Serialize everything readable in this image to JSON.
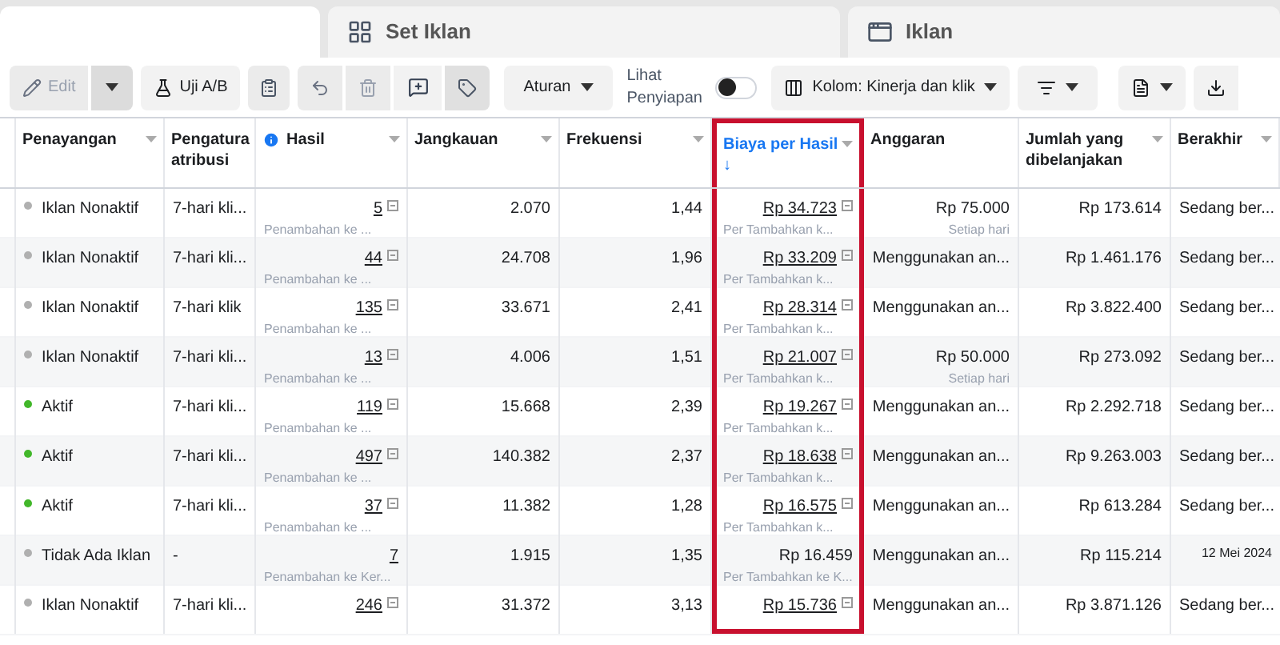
{
  "tabs": [
    {
      "selected": true
    },
    {
      "label": "Set Iklan",
      "selected": false
    },
    {
      "label": "Iklan",
      "selected": false
    }
  ],
  "toolbar": {
    "edit": "Edit",
    "ab_test": "Uji A/B",
    "rules": "Aturan",
    "preview_label": "Lihat Penyiapan",
    "preview_on": false,
    "columns": "Kolom: Kinerja dan klik"
  },
  "columns": [
    {
      "label": "Penayangan",
      "menu": true,
      "info": false,
      "highlighted": false
    },
    {
      "label": "Pengatura atribusi",
      "menu": false,
      "info": false,
      "highlighted": false
    },
    {
      "label": "Hasil",
      "menu": true,
      "info": true,
      "highlighted": false
    },
    {
      "label": "Jangkauan",
      "menu": true,
      "info": false,
      "highlighted": false
    },
    {
      "label": "Frekuensi",
      "menu": true,
      "info": false,
      "highlighted": false
    },
    {
      "label": "Biaya per Hasil",
      "sort_arrow": "↓",
      "menu": true,
      "info": false,
      "highlighted": true
    },
    {
      "label": "Anggaran",
      "menu": false,
      "info": false,
      "highlighted": false
    },
    {
      "label": "Jumlah yang dibelanjakan",
      "menu": true,
      "info": false,
      "highlighted": false
    },
    {
      "label": "Berakhir",
      "menu": true,
      "info": false,
      "highlighted": false
    }
  ],
  "rows": [
    {
      "status": "Iklan Nonaktif",
      "active": false,
      "attribution": "7-hari kli...",
      "result": "5",
      "result_linked": true,
      "result_sub": "Penambahan ke ...",
      "reach": "2.070",
      "frequency": "1,44",
      "cost": "Rp 34.723",
      "cost_linked": true,
      "cost_sub": "Per Tambahkan k...",
      "budget": "Rp 75.000",
      "budget_sub": "Setiap hari",
      "spent": "Rp 173.614",
      "ends": "Sedang ber...",
      "ends_is_date": false
    },
    {
      "status": "Iklan Nonaktif",
      "active": false,
      "attribution": "7-hari kli...",
      "result": "44",
      "result_linked": true,
      "result_sub": "Penambahan ke ...",
      "reach": "24.708",
      "frequency": "1,96",
      "cost": "Rp 33.209",
      "cost_linked": true,
      "cost_sub": "Per Tambahkan k...",
      "budget": "Menggunakan an...",
      "spent": "Rp 1.461.176",
      "ends": "Sedang ber...",
      "ends_is_date": false
    },
    {
      "status": "Iklan Nonaktif",
      "active": false,
      "attribution": "7-hari klik",
      "result": "135",
      "result_linked": true,
      "result_sub": "Penambahan ke ...",
      "reach": "33.671",
      "frequency": "2,41",
      "cost": "Rp 28.314",
      "cost_linked": true,
      "cost_sub": "Per Tambahkan k...",
      "budget": "Menggunakan an...",
      "spent": "Rp 3.822.400",
      "ends": "Sedang ber...",
      "ends_is_date": false
    },
    {
      "status": "Iklan Nonaktif",
      "active": false,
      "attribution": "7-hari kli...",
      "result": "13",
      "result_linked": true,
      "result_sub": "Penambahan ke ...",
      "reach": "4.006",
      "frequency": "1,51",
      "cost": "Rp 21.007",
      "cost_linked": true,
      "cost_sub": "Per Tambahkan k...",
      "budget": "Rp 50.000",
      "budget_sub": "Setiap hari",
      "spent": "Rp 273.092",
      "ends": "Sedang ber...",
      "ends_is_date": false
    },
    {
      "status": "Aktif",
      "active": true,
      "attribution": "7-hari kli...",
      "result": "119",
      "result_linked": true,
      "result_sub": "Penambahan ke ...",
      "reach": "15.668",
      "frequency": "2,39",
      "cost": "Rp 19.267",
      "cost_linked": true,
      "cost_sub": "Per Tambahkan k...",
      "budget": "Menggunakan an...",
      "spent": "Rp 2.292.718",
      "ends": "Sedang ber...",
      "ends_is_date": false
    },
    {
      "status": "Aktif",
      "active": true,
      "attribution": "7-hari kli...",
      "result": "497",
      "result_linked": true,
      "result_sub": "Penambahan ke ...",
      "reach": "140.382",
      "frequency": "2,37",
      "cost": "Rp 18.638",
      "cost_linked": true,
      "cost_sub": "Per Tambahkan k...",
      "budget": "Menggunakan an...",
      "spent": "Rp 9.263.003",
      "ends": "Sedang ber...",
      "ends_is_date": false
    },
    {
      "status": "Aktif",
      "active": true,
      "attribution": "7-hari kli...",
      "result": "37",
      "result_linked": true,
      "result_sub": "Penambahan ke ...",
      "reach": "11.382",
      "frequency": "1,28",
      "cost": "Rp 16.575",
      "cost_linked": true,
      "cost_sub": "Per Tambahkan k...",
      "budget": "Menggunakan an...",
      "spent": "Rp 613.284",
      "ends": "Sedang ber...",
      "ends_is_date": false
    },
    {
      "status": "Tidak Ada Iklan",
      "active": false,
      "attribution": "-",
      "result": "7",
      "result_linked": false,
      "result_sub": "Penambahan ke Ker...",
      "reach": "1.915",
      "frequency": "1,35",
      "cost": "Rp 16.459",
      "cost_linked": false,
      "cost_sub": "Per Tambahkan ke K...",
      "budget": "Menggunakan an...",
      "spent": "Rp 115.214",
      "ends": "12 Mei 2024",
      "ends_is_date": true
    },
    {
      "status": "Iklan Nonaktif",
      "active": false,
      "attribution": "7-hari kli...",
      "result": "246",
      "result_linked": true,
      "reach": "31.372",
      "frequency": "3,13",
      "cost": "Rp 15.736",
      "cost_linked": true,
      "budget": "Menggunakan an...",
      "spent": "Rp 3.871.126",
      "ends": "Sedang ber...",
      "ends_is_date": false
    }
  ]
}
